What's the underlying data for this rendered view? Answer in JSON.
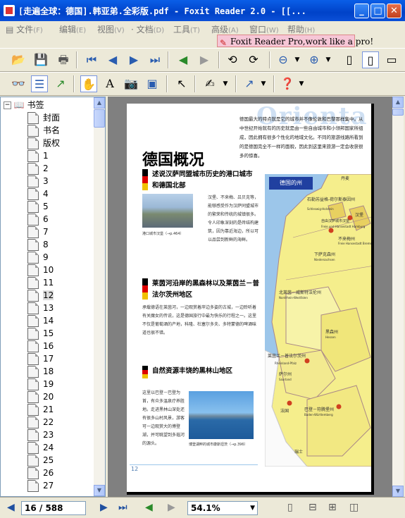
{
  "window": {
    "title": "[走遍全球：德国].韩亚弟.全彩版.pdf - Foxit Reader 2.0 - [[..."
  },
  "menu": {
    "items": [
      {
        "label": "文件",
        "key": "(F)"
      },
      {
        "label": "编辑",
        "key": "(E)"
      },
      {
        "label": "视图",
        "key": "(V)"
      },
      {
        "label": "文档",
        "key": "(D)"
      },
      {
        "label": "工具",
        "key": "(T)"
      },
      {
        "label": "高级",
        "key": "(A)"
      },
      {
        "label": "窗口",
        "key": "(W)"
      },
      {
        "label": "帮助",
        "key": "(H)"
      }
    ],
    "promo": "Foxit Reader Pro,work like a pro!"
  },
  "bookmarks": {
    "root": "书签",
    "items": [
      "封面",
      "书名",
      "版权",
      "1",
      "2",
      "3",
      "4",
      "5",
      "6",
      "7",
      "8",
      "9",
      "10",
      "11",
      "12",
      "13",
      "14",
      "15",
      "16",
      "17",
      "18",
      "19",
      "20",
      "21",
      "22",
      "23",
      "24",
      "25",
      "26",
      "27"
    ],
    "selected": "12"
  },
  "doc": {
    "intro": "德国最大的特点就是它的城市并不像伦敦和巴黎那样集中。从中世纪开始就有的历史就是由一些自由城市和小领邦国家所组成，因此拥有很多个性化的地域文化。不同的旅游线路所看到的是德国完全不一样的面貌，因此到这里来旅游一定会收获很多的惊喜。",
    "watermark": "Orienta",
    "main_title": "德国概况",
    "sec1_title": "述说汉萨同盟城市历史的港口城市和德国北部",
    "sec1_body": "汉堡、不来梅、吕贝克等，能够感受作为汉萨同盟城市的繁荣和传统的城镇很多。令人印象深刻的是砖结构建筑，因为靠近海边，所以可以品尝到新鲜的海鲜。",
    "sec1_caption": "港口城市汉堡（→p.464）",
    "sec2_title": "莱茵河沿岸的黑森林以及莱茵兰－普法尔茨州地区",
    "sec2_body": "承载德语在莱茵河，一边观赏着岸边多姿的古城，一边聆听着有关魔女的传说，这是德国旅行中最为快乐的行程之一。这里不仅是葡萄酒的产地，科隆、杜塞尔多夫、多特蒙德的啤酒味道也很不错。",
    "sec3_title": "自然资源丰饶的黑林山地区",
    "sec3_body": "这里以巴登－巴登为首，有众多温泉疗养胜地。走进黑林山深处还有很多山村风景，游客可一边观赏大的博登湖，并可眺望到多瑙河的源头。",
    "sec3_caption": "博登湖畔的城市康斯坦茨（→p.396）",
    "page_number": "12",
    "map_title": "德国的州",
    "map_labels": [
      {
        "cn": "丹麦",
        "en": ""
      },
      {
        "cn": "石勒苏益格-荷尔斯泰因州",
        "en": "Schleswig-Holstein"
      },
      {
        "cn": "汉堡",
        "en": ""
      },
      {
        "cn": "自由汉萨城市汉堡",
        "en": "Freie und Hansestadt Hamburg"
      },
      {
        "cn": "不来梅州",
        "en": "Freie Hansestadt Bremen"
      },
      {
        "cn": "下萨克森州",
        "en": "Niedersachsen"
      },
      {
        "cn": "北莱茵－威斯特法伦州",
        "en": "Nordrhein-Westfalen"
      },
      {
        "cn": "黑森州",
        "en": "Hessen"
      },
      {
        "cn": "莱茵兰－普法尔茨州",
        "en": "Rheinland-Pfalz"
      },
      {
        "cn": "萨尔州",
        "en": "Saarland"
      },
      {
        "cn": "巴登－符腾堡州",
        "en": "Baden-Württemberg"
      },
      {
        "cn": "法国",
        "en": ""
      },
      {
        "cn": "瑞士",
        "en": ""
      }
    ]
  },
  "status": {
    "page": "16 / 588",
    "zoom": "54.1%"
  },
  "colors": {
    "accent": "#0A5FE8",
    "map_water": "#9CC6EA",
    "map_land": "#F5EE8C",
    "promo_bg": "#F6C6D6"
  }
}
